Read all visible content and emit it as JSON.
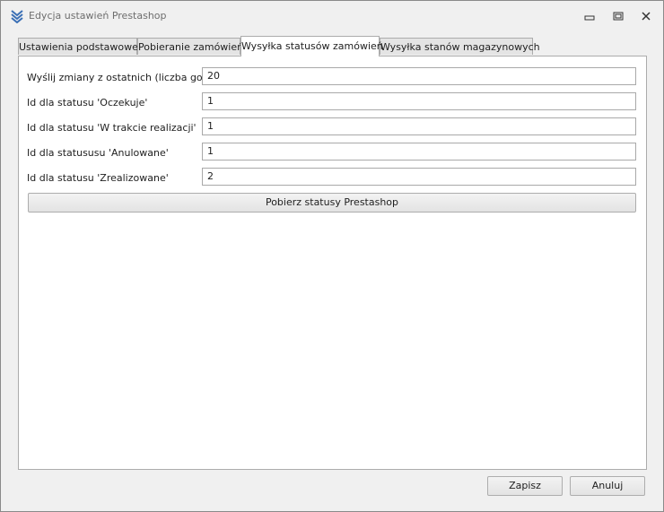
{
  "window": {
    "title": "Edycja ustawień Prestashop",
    "icon": "chevrons-down-icon"
  },
  "tabs": [
    {
      "label": "Ustawienia podstawowe",
      "active": false
    },
    {
      "label": "Pobieranie zamówień",
      "active": false
    },
    {
      "label": "Wysyłka statusów zamówień",
      "active": true
    },
    {
      "label": "Wysyłka stanów magazynowych",
      "active": false
    }
  ],
  "form": {
    "fields": [
      {
        "label": "Wyślij zmiany z ostatnich (liczba godzin)",
        "value": "20"
      },
      {
        "label": "Id dla statusu 'Oczekuje'",
        "value": "1"
      },
      {
        "label": "Id dla statusu 'W trakcie realizacji'",
        "value": "1"
      },
      {
        "label": "Id dla statususu 'Anulowane'",
        "value": "1"
      },
      {
        "label": "Id dla statusu 'Zrealizowane'",
        "value": "2"
      }
    ],
    "fetch_button": "Pobierz statusy Prestashop"
  },
  "footer": {
    "save_label": "Zapisz",
    "cancel_label": "Anuluj"
  }
}
